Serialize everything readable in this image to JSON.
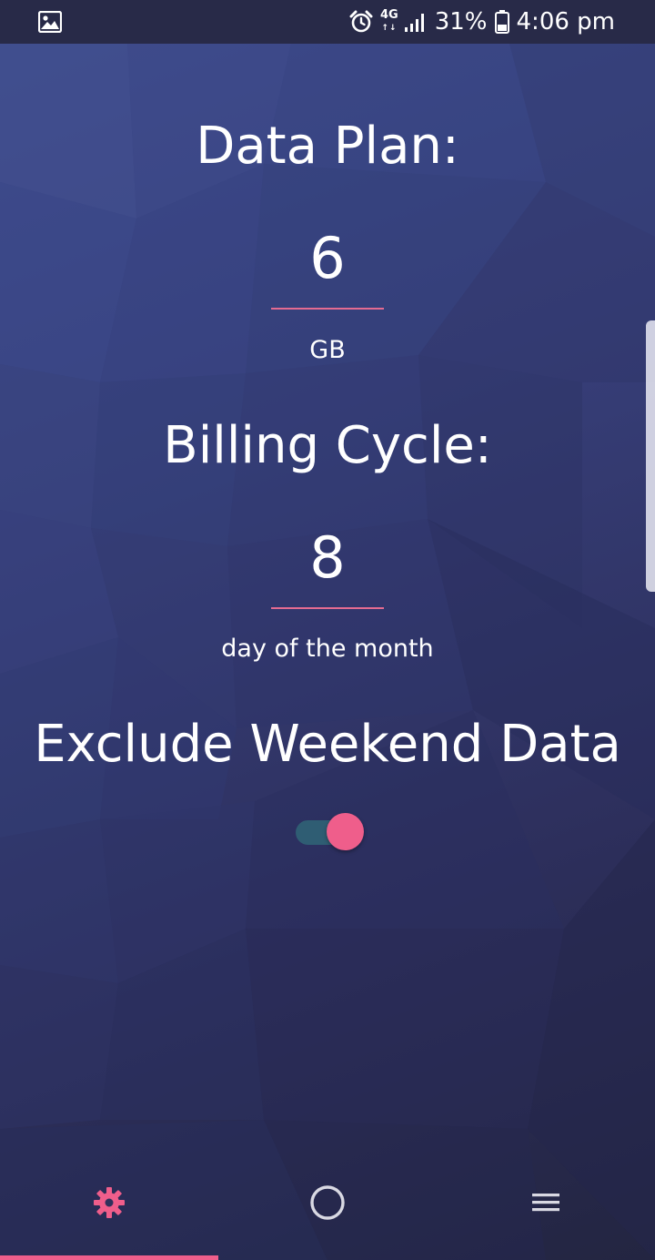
{
  "status_bar": {
    "network": "4G",
    "battery": "31%",
    "time": "4:06 pm",
    "icons": [
      "gallery-icon",
      "alarm-icon",
      "signal-icon",
      "battery-icon"
    ]
  },
  "settings": {
    "data_plan": {
      "title": "Data Plan:",
      "value": "6",
      "unit": "GB"
    },
    "billing_cycle": {
      "title": "Billing Cycle:",
      "value": "8",
      "unit": "day of the month"
    },
    "exclude_weekend": {
      "title": "Exclude Weekend Data",
      "enabled": true
    }
  },
  "bottom_nav": {
    "items": [
      {
        "icon": "gear-icon",
        "active": true
      },
      {
        "icon": "circle-icon",
        "active": false
      },
      {
        "icon": "menu-icon",
        "active": false
      }
    ]
  },
  "colors": {
    "accent": "#ef5e8b",
    "toggle_track": "#2f5d73",
    "status_bar": "#282a48",
    "background_top": "#3f4d8f",
    "background_bottom": "#232541"
  }
}
